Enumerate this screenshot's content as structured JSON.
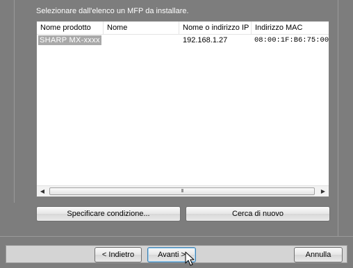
{
  "instruction": "Selezionare dall'elenco un MFP da installare.",
  "list": {
    "columns": [
      "Nome prodotto",
      "Nome",
      "Nome o indirizzo IP",
      "Indirizzo MAC"
    ],
    "rows": [
      {
        "product": "SHARP MX-xxxx",
        "name": "",
        "ip": "192.168.1.27",
        "mac": "08:00:1F:B6:75:00",
        "selected": true
      }
    ],
    "scroll_grip": "III"
  },
  "buttons": {
    "specify": "Specificare condizione...",
    "search": "Cerca di nuovo",
    "back": "< Indietro",
    "next": "Avanti >",
    "cancel": "Annulla"
  },
  "icons": {
    "scroll_left": "triangle-left",
    "scroll_right": "triangle-right",
    "cursor": "mouse-pointer"
  },
  "colors": {
    "dialog_background": "#7d7d7d",
    "selection": "#a9a9a9",
    "focus_border": "#3c7fb1"
  }
}
